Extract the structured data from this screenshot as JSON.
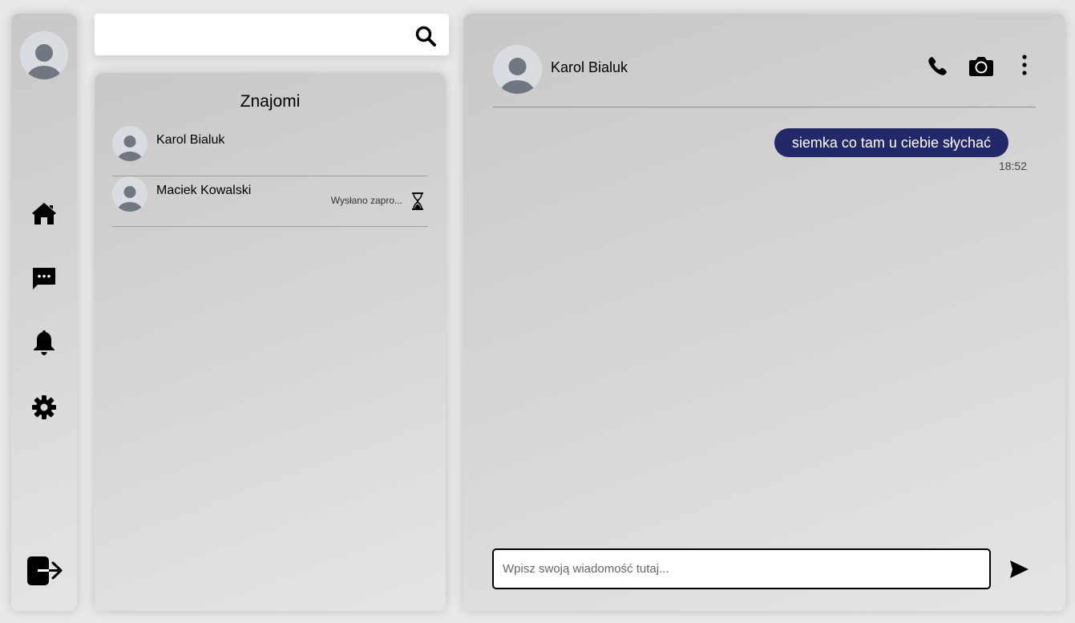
{
  "sidebar": {
    "icons": [
      "user-avatar",
      "home-icon",
      "chat-icon",
      "bell-icon",
      "gear-icon",
      "logout-icon"
    ]
  },
  "search": {
    "value": "",
    "placeholder": ""
  },
  "friends": {
    "title": "Znajomi",
    "items": [
      {
        "name": "Karol Bialuk",
        "status": ""
      },
      {
        "name": "Maciek Kowalski",
        "status": "Wysłano zapro..."
      }
    ]
  },
  "chat": {
    "contact_name": "Karol Bialuk",
    "messages": [
      {
        "text": "siemka co tam u ciebie słychać",
        "time": "18:52"
      }
    ],
    "input": {
      "value": "",
      "placeholder": "Wpisz swoją wiadomość tutaj..."
    }
  },
  "colors": {
    "bubble": "#232869",
    "panel": "#d4d2d3"
  }
}
